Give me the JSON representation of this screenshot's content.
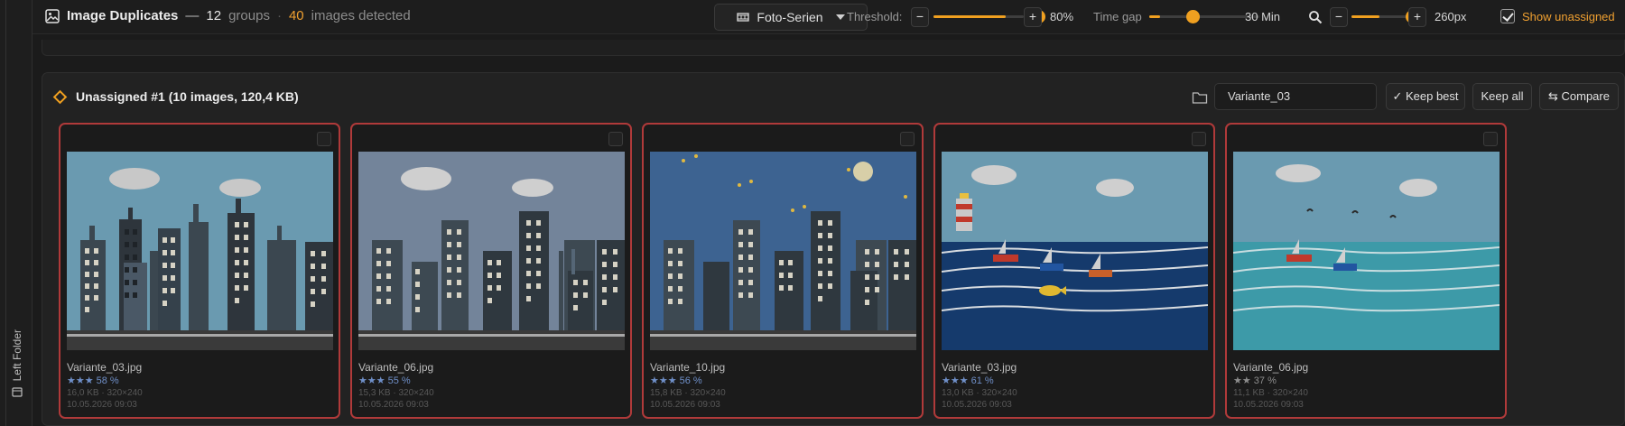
{
  "sidebar": {
    "label": "Left Folder"
  },
  "header": {
    "title": "Image Duplicates",
    "separator": "—",
    "group_count": "12",
    "groups_label": "groups",
    "dot": "·",
    "image_count": "40",
    "images_label": "images detected"
  },
  "toolbar": {
    "series_label": "Foto-Serien",
    "threshold_label": "Threshold:",
    "threshold_minus": "−",
    "threshold_plus": "+",
    "threshold_value": "80%",
    "threshold_level": 0.8,
    "timegap_label": "Time gap",
    "timegap_value": "30 Min",
    "timegap_level": 0.1,
    "zoom_minus": "−",
    "zoom_plus": "+",
    "zoom_value": "260px",
    "zoom_level": 0.5,
    "show_unassigned_label": "Show unassigned",
    "show_unassigned_checked": true
  },
  "group": {
    "title": "Unassigned #1 (10 images, 120,4 KB)",
    "folder_value": "Variante_03",
    "keep_best_label": "✓ Keep best",
    "keep_all_label": "Keep all",
    "compare_label": "⇆ Compare"
  },
  "cards": [
    {
      "filename": "Variante_03.jpg",
      "rating": "★★★ 58 %",
      "meta": "16,0 KB · 320×240",
      "date": "10.05.2026 09:03"
    },
    {
      "filename": "Variante_06.jpg",
      "rating": "★★★ 55 %",
      "meta": "15,3 KB · 320×240",
      "date": "10.05.2026 09:03"
    },
    {
      "filename": "Variante_10.jpg",
      "rating": "★★★ 56 %",
      "meta": "15,8 KB · 320×240",
      "date": "10.05.2026 09:03"
    },
    {
      "filename": "Variante_03.jpg",
      "rating": "★★★ 61 %",
      "meta": "13,0 KB · 320×240",
      "date": "10.05.2026 09:03"
    },
    {
      "filename": "Variante_06.jpg",
      "rating": "★★ 37 %",
      "meta": "11,1 KB · 320×240",
      "date": "10.05.2026 09:03"
    }
  ],
  "colors": {
    "accent": "#f0a020",
    "card_border": "#b03a3a",
    "rating_blue": "#6f8fc8"
  }
}
